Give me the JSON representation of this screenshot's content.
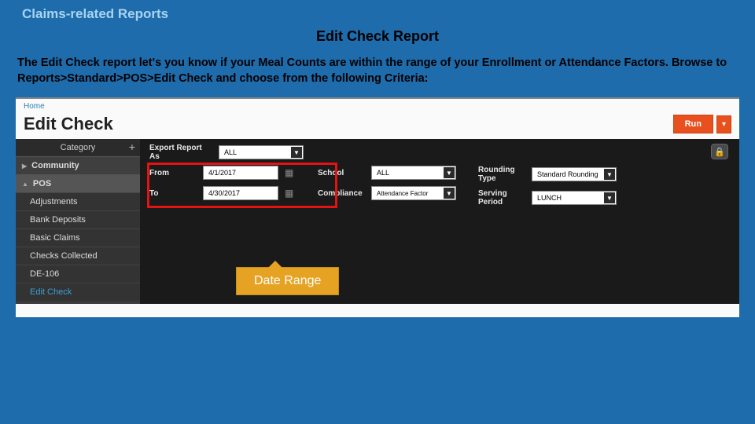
{
  "slide": {
    "header": "Claims-related Reports",
    "title": "Edit Check Report",
    "intro_prefix": "The ",
    "intro_bold": "Edit Check",
    "intro_rest": " report let's you know if your Meal Counts are within the range of your Enrollment or Attendance Factors. Browse to Reports>Standard>POS>Edit Check and choose from the following Criteria:",
    "callout": "Date Range"
  },
  "app": {
    "breadcrumb": "Home",
    "title": "Edit Check",
    "run_label": "Run"
  },
  "sidebar": {
    "heading": "Category",
    "groups": [
      {
        "label": "Community",
        "expanded": false
      },
      {
        "label": "POS",
        "expanded": true
      }
    ],
    "items": [
      "Adjustments",
      "Bank Deposits",
      "Basic Claims",
      "Checks Collected",
      "DE-106",
      "Edit Check"
    ],
    "active_item": "Edit Check"
  },
  "config": {
    "export_label": "Export Report As",
    "export_value": "ALL",
    "from_label": "From",
    "from_value": "4/1/2017",
    "to_label": "To",
    "to_value": "4/30/2017",
    "school_label": "School",
    "school_value": "ALL",
    "compliance_label": "Compliance",
    "compliance_value": "Attendance Factor",
    "rounding_label": "Rounding Type",
    "rounding_value": "Standard Rounding",
    "serving_label": "Serving Period",
    "serving_value": "LUNCH"
  }
}
